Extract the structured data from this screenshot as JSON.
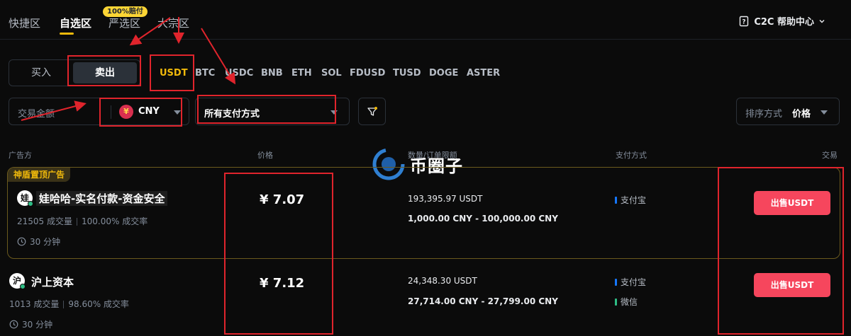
{
  "nav": {
    "tabs": [
      "快捷区",
      "自选区",
      "严选区",
      "大宗区"
    ],
    "badge": "100%赔付",
    "help": "C2C 帮助中心"
  },
  "trade_toggle": {
    "buy": "买入",
    "sell": "卖出"
  },
  "coins": [
    "USDT",
    "BTC",
    "USDC",
    "BNB",
    "ETH",
    "SOL",
    "FDUSD",
    "TUSD",
    "DOGE",
    "ASTER"
  ],
  "filters": {
    "amount_placeholder": "交易金额",
    "currency": "CNY",
    "currency_icon": "¥",
    "payment": "所有支付方式",
    "sort_label": "排序方式",
    "sort_value": "价格"
  },
  "table_headers": [
    "广告方",
    "价格",
    "数量/订单限额",
    "支付方式",
    "交易"
  ],
  "watermark": "币圈子",
  "ads": [
    {
      "promo": "神盾置顶广告",
      "avatar": "娃",
      "name": "娃哈哈-实名付款-资金安全",
      "volume": "21505 成交量",
      "rate": "100.00% 成交率",
      "time": "30 分钟",
      "price": "¥ 7.07",
      "available": "193,395.97 USDT",
      "limit": "1,000.00 CNY - 100,000.00 CNY",
      "payments": [
        {
          "name": "支付宝",
          "color": "#1677ff"
        }
      ],
      "action": "出售USDT"
    },
    {
      "avatar": "沪",
      "name": "沪上资本",
      "volume": "1013 成交量",
      "rate": "98.60% 成交率",
      "time": "30 分钟",
      "price": "¥ 7.12",
      "available": "24,348.30 USDT",
      "limit": "27,714.00 CNY - 27,799.00 CNY",
      "payments": [
        {
          "name": "支付宝",
          "color": "#1677ff"
        },
        {
          "name": "微信",
          "color": "#2ebd85"
        }
      ],
      "action": "出售USDT"
    }
  ],
  "colors": {
    "accent": "#f0b90b",
    "sell": "#f6465d",
    "annotation": "#e0242c"
  }
}
